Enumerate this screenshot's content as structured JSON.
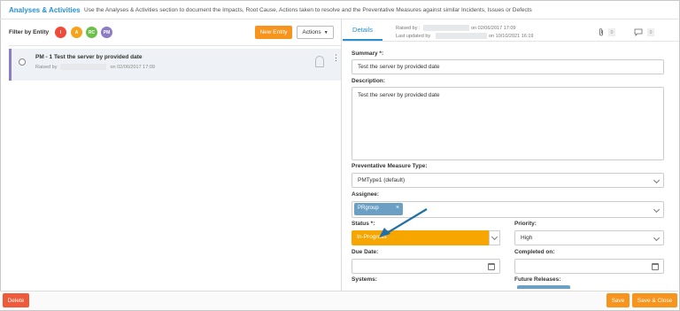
{
  "header": {
    "title": "Analyses & Activities",
    "description": "Use the Analyses & Activities section to document the Impacts, Root Cause, Actions taken to resolve and the Preventative Measures against similar Incidents, Issues or Defects"
  },
  "filter": {
    "label": "Filter by Entity",
    "chips": [
      {
        "label": "I",
        "color": "#ee4b3a"
      },
      {
        "label": "A",
        "color": "#f7a21b"
      },
      {
        "label": "RC",
        "color": "#6cc04a"
      },
      {
        "label": "PM",
        "color": "#8e7cc3"
      }
    ]
  },
  "toolbar": {
    "new_entity": "New Entity",
    "actions": "Actions"
  },
  "list": {
    "items": [
      {
        "title": "PM - 1 Test the server by provided date",
        "raised_by_label": "Raised by",
        "raised_on": "on 02/06/2017 17:09"
      }
    ]
  },
  "details": {
    "tab": "Details",
    "raised_by_label": "Raised by :",
    "raised_on": "on 02/06/2017 17:09",
    "last_updated_label": "Last updated by",
    "last_updated_on": "on 10/10/2021 16:19",
    "attachments_count": "0",
    "comments_count": "0",
    "summary_label": "Summary *:",
    "summary_value": "Test the server by provided date",
    "description_label": "Description:",
    "description_value": "Test the server by provided date",
    "pm_type_label": "Preventative Measure Type:",
    "pm_type_value": "PMType1 (default)",
    "assignee_label": "Assignee:",
    "assignee_tag": "PRgroup",
    "status_label": "Status *:",
    "status_value": "In-Progress",
    "priority_label": "Priority:",
    "priority_value": "High",
    "due_date_label": "Due Date:",
    "completed_on_label": "Completed on:",
    "systems_label": "Systems:",
    "future_releases_label": "Future Releases:"
  },
  "colors": {
    "accent": "#2b8fd0",
    "orange": "#f7941d",
    "status": "#f7a600",
    "delete": "#ee5a3a"
  },
  "footer": {
    "delete": "Delete",
    "save": "Save",
    "save_close": "Save & Close"
  }
}
